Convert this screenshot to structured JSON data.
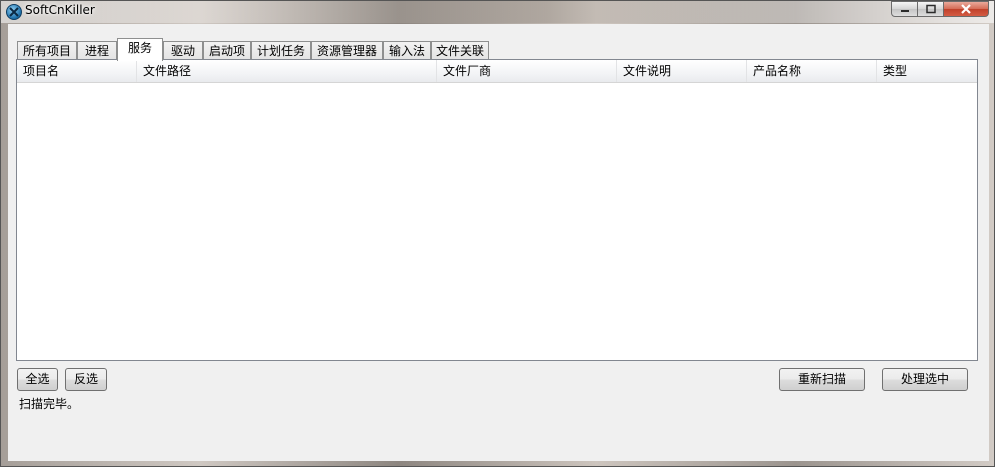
{
  "window": {
    "title": "SoftCnKiller"
  },
  "tabs": [
    {
      "label": "所有项目",
      "active": false
    },
    {
      "label": "进程",
      "active": false
    },
    {
      "label": "服务",
      "active": true
    },
    {
      "label": "驱动",
      "active": false
    },
    {
      "label": "启动项",
      "active": false
    },
    {
      "label": "计划任务",
      "active": false
    },
    {
      "label": "资源管理器",
      "active": false
    },
    {
      "label": "输入法",
      "active": false
    },
    {
      "label": "文件关联",
      "active": false
    }
  ],
  "table": {
    "columns": [
      "项目名",
      "文件路径",
      "文件厂商",
      "文件说明",
      "产品名称",
      "类型"
    ],
    "rows": []
  },
  "buttons": {
    "select_all": "全选",
    "invert_selection": "反选",
    "rescan": "重新扫描",
    "process_selected": "处理选中"
  },
  "status": {
    "text": "扫描完毕。"
  },
  "icons": {
    "app": "x-logo-icon",
    "minimize": "minimize-icon",
    "maximize": "maximize-icon",
    "close": "close-icon"
  }
}
